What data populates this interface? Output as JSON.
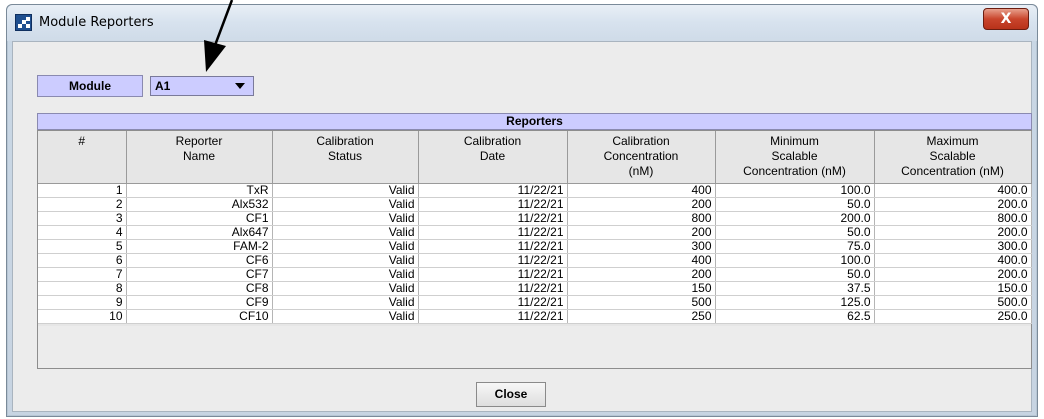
{
  "window": {
    "title": "Module Reporters",
    "close_glyph": "X"
  },
  "module": {
    "label": "Module",
    "value": "A1"
  },
  "reporters": {
    "title": "Reporters",
    "columns": [
      [
        "#"
      ],
      [
        "Reporter",
        "Name"
      ],
      [
        "Calibration",
        "Status"
      ],
      [
        "Calibration",
        "Date"
      ],
      [
        "Calibration",
        "Concentration",
        "(nM)"
      ],
      [
        "Minimum",
        "Scalable",
        "Concentration (nM)"
      ],
      [
        "Maximum",
        "Scalable",
        "Concentration (nM)"
      ]
    ],
    "rows": [
      [
        "1",
        "TxR",
        "Valid",
        "11/22/21",
        "400",
        "100.0",
        "400.0"
      ],
      [
        "2",
        "Alx532",
        "Valid",
        "11/22/21",
        "200",
        "50.0",
        "200.0"
      ],
      [
        "3",
        "CF1",
        "Valid",
        "11/22/21",
        "800",
        "200.0",
        "800.0"
      ],
      [
        "4",
        "Alx647",
        "Valid",
        "11/22/21",
        "200",
        "50.0",
        "200.0"
      ],
      [
        "5",
        "FAM-2",
        "Valid",
        "11/22/21",
        "300",
        "75.0",
        "300.0"
      ],
      [
        "6",
        "CF6",
        "Valid",
        "11/22/21",
        "400",
        "100.0",
        "400.0"
      ],
      [
        "7",
        "CF7",
        "Valid",
        "11/22/21",
        "200",
        "50.0",
        "200.0"
      ],
      [
        "8",
        "CF8",
        "Valid",
        "11/22/21",
        "150",
        "37.5",
        "150.0"
      ],
      [
        "9",
        "CF9",
        "Valid",
        "11/22/21",
        "500",
        "125.0",
        "500.0"
      ],
      [
        "10",
        "CF10",
        "Valid",
        "11/22/21",
        "250",
        "62.5",
        "250.0"
      ]
    ]
  },
  "buttons": {
    "close": "Close"
  },
  "colors": {
    "header_lavender": "#ccccff",
    "close_red": "#c9452c"
  }
}
